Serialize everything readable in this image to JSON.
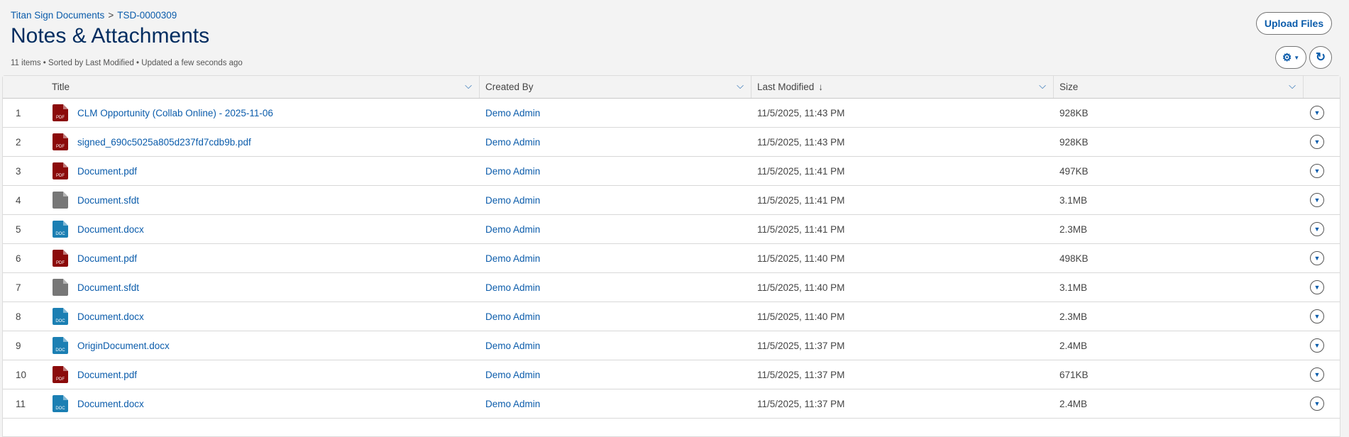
{
  "breadcrumb": {
    "parent": "Titan Sign Documents",
    "separator": ">",
    "record": "TSD-0000309"
  },
  "page_title": "Notes & Attachments",
  "meta": "11 items • Sorted by Last Modified • Updated a few seconds ago",
  "buttons": {
    "upload": "Upload Files"
  },
  "columns": {
    "title": "Title",
    "created_by": "Created By",
    "last_modified": "Last Modified",
    "size": "Size",
    "sort_arrow": "↓"
  },
  "icon_colors": {
    "pdf": "#8b0a0a",
    "doc": "#1b7fb3",
    "generic": "#777777"
  },
  "rows": [
    {
      "n": "1",
      "type": "pdf",
      "title": "CLM Opportunity (Collab Online) - 2025-11-06",
      "by": "Demo Admin",
      "modified": "11/5/2025, 11:43 PM",
      "size": "928KB"
    },
    {
      "n": "2",
      "type": "pdf",
      "title": "signed_690c5025a805d237fd7cdb9b.pdf",
      "by": "Demo Admin",
      "modified": "11/5/2025, 11:43 PM",
      "size": "928KB"
    },
    {
      "n": "3",
      "type": "pdf",
      "title": "Document.pdf",
      "by": "Demo Admin",
      "modified": "11/5/2025, 11:41 PM",
      "size": "497KB"
    },
    {
      "n": "4",
      "type": "generic",
      "title": "Document.sfdt",
      "by": "Demo Admin",
      "modified": "11/5/2025, 11:41 PM",
      "size": "3.1MB"
    },
    {
      "n": "5",
      "type": "doc",
      "title": "Document.docx",
      "by": "Demo Admin",
      "modified": "11/5/2025, 11:41 PM",
      "size": "2.3MB"
    },
    {
      "n": "6",
      "type": "pdf",
      "title": "Document.pdf",
      "by": "Demo Admin",
      "modified": "11/5/2025, 11:40 PM",
      "size": "498KB"
    },
    {
      "n": "7",
      "type": "generic",
      "title": "Document.sfdt",
      "by": "Demo Admin",
      "modified": "11/5/2025, 11:40 PM",
      "size": "3.1MB"
    },
    {
      "n": "8",
      "type": "doc",
      "title": "Document.docx",
      "by": "Demo Admin",
      "modified": "11/5/2025, 11:40 PM",
      "size": "2.3MB"
    },
    {
      "n": "9",
      "type": "doc",
      "title": "OriginDocument.docx",
      "by": "Demo Admin",
      "modified": "11/5/2025, 11:37 PM",
      "size": "2.4MB"
    },
    {
      "n": "10",
      "type": "pdf",
      "title": "Document.pdf",
      "by": "Demo Admin",
      "modified": "11/5/2025, 11:37 PM",
      "size": "671KB"
    },
    {
      "n": "11",
      "type": "doc",
      "title": "Document.docx",
      "by": "Demo Admin",
      "modified": "11/5/2025, 11:37 PM",
      "size": "2.4MB"
    }
  ]
}
